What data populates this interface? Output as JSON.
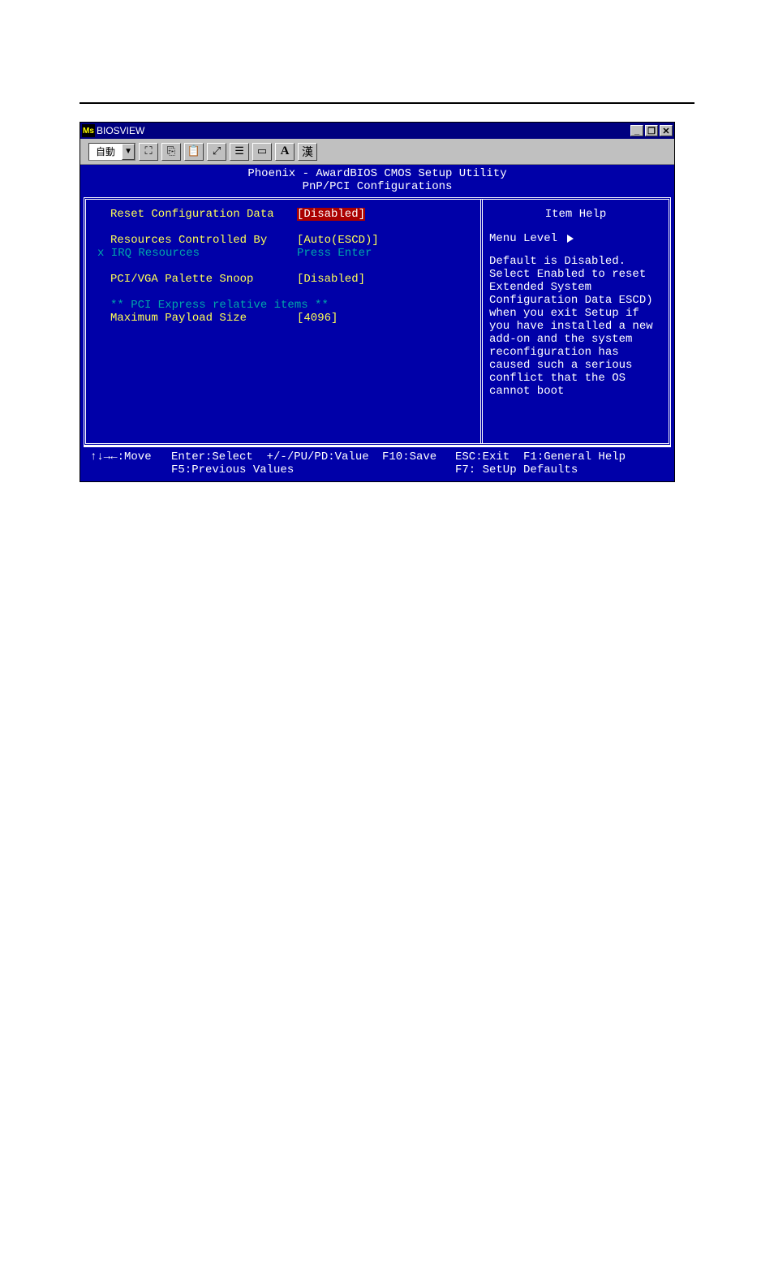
{
  "window": {
    "title": "BIOSVIEW",
    "logo_text": "Ms",
    "btn_min": "_",
    "btn_max": "❐",
    "btn_close": "✕"
  },
  "toolbar": {
    "combo_value": "自動",
    "combo_arrow": "▼",
    "btn_marquee": "⛶",
    "btn_copy": "⎘",
    "btn_paste": "📋",
    "btn_fullscreen": "⤢",
    "btn_props": "☰",
    "btn_window": "▭",
    "btn_font": "A",
    "btn_cjk": "漢"
  },
  "bios": {
    "header_line1": "Phoenix - AwardBIOS CMOS Setup Utility",
    "header_line2": "PnP/PCI Configurations",
    "items": {
      "reset_cfg_label": "Reset Configuration Data",
      "reset_cfg_value": "[Disabled]",
      "res_ctrl_label": "Resources Controlled By",
      "res_ctrl_value": "[Auto(ESCD)]",
      "irq_label": "x IRQ Resources",
      "irq_value": "Press Enter",
      "palette_label": "PCI/VGA Palette Snoop",
      "palette_value": "[Disabled]",
      "pci_section": "** PCI Express relative items **",
      "payload_label": "Maximum Payload Size",
      "payload_value": "[4096]"
    },
    "help": {
      "title": "Item Help",
      "menu_level": "Menu Level",
      "text": "Default is Disabled. Select Enabled to reset Extended System Configuration Data ESCD) when you exit Setup if you have installed a new add-on and the system reconfiguration has caused such a serious conflict that the OS cannot boot"
    },
    "footer": {
      "move": "↑↓→←:Move",
      "enter": "Enter:Select  +/-/PU/PD:Value",
      "f10": "F10:Save",
      "esc": "ESC:Exit  F1:General Help",
      "f5": "F5:Previous Values",
      "f7": "F7: SetUp Defaults"
    }
  }
}
